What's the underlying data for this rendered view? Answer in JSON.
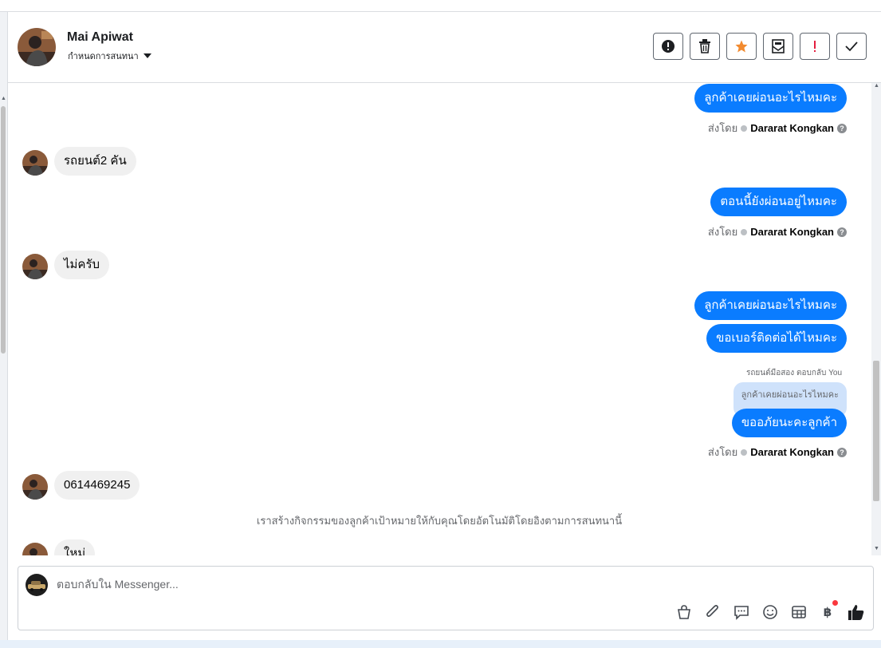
{
  "header": {
    "contact_name": "Mai Apiwat",
    "subtitle": "กำหนดการสนทนา",
    "actions": [
      {
        "icon": "exclamation-circle-icon",
        "label": "mark-important"
      },
      {
        "icon": "trash-icon",
        "label": "delete"
      },
      {
        "icon": "star-icon",
        "label": "star",
        "color": "#f28a2e"
      },
      {
        "icon": "envelope-icon",
        "label": "mark-unread"
      },
      {
        "icon": "spam-icon",
        "label": "spam",
        "color": "#e41e3f"
      },
      {
        "icon": "check-icon",
        "label": "done"
      }
    ]
  },
  "messages": {
    "m1": "ลูกค้าเคยผ่อนอะไรไหมคะ",
    "sent_label": "ส่งโดย",
    "agent": "Dararat Kongkan",
    "m2": "รถยนต์2 คัน",
    "m3": "ตอนนี้ยังผ่อนอยู่ไหมคะ",
    "m4": "ไม่ครับ",
    "m5": "ลูกค้าเคยผ่อนอะไรไหมคะ",
    "m6": "ขอเบอร์ติดต่อได้ไหมคะ",
    "reply_meta": "รถยนต์มือสอง ตอบกลับ You",
    "quoted": "ลูกค้าเคยผ่อนอะไรไหมคะ",
    "m7": "ขออภัยนะคะลูกค้า",
    "m8": "0614469245",
    "system_note": "เราสร้างกิจกรรมของลูกค้าเป้าหมายให้กับคุณโดยอัตโนมัติโดยอิงตามการสนทนานี้",
    "m9": "ใหม่"
  },
  "composer": {
    "placeholder": "ตอบกลับใน Messenger...",
    "value": "",
    "tools": [
      "shopping-bag-icon",
      "paperclip-icon",
      "chat-bubble-icon",
      "emoji-icon",
      "table-icon",
      "baht-icon",
      "thumbs-up-icon"
    ],
    "baht_symbol": "฿"
  },
  "colors": {
    "outgoing_bubble": "#0a7cff",
    "incoming_bubble": "#f0f0f0",
    "quoted_bubble": "#cfe2fb"
  }
}
